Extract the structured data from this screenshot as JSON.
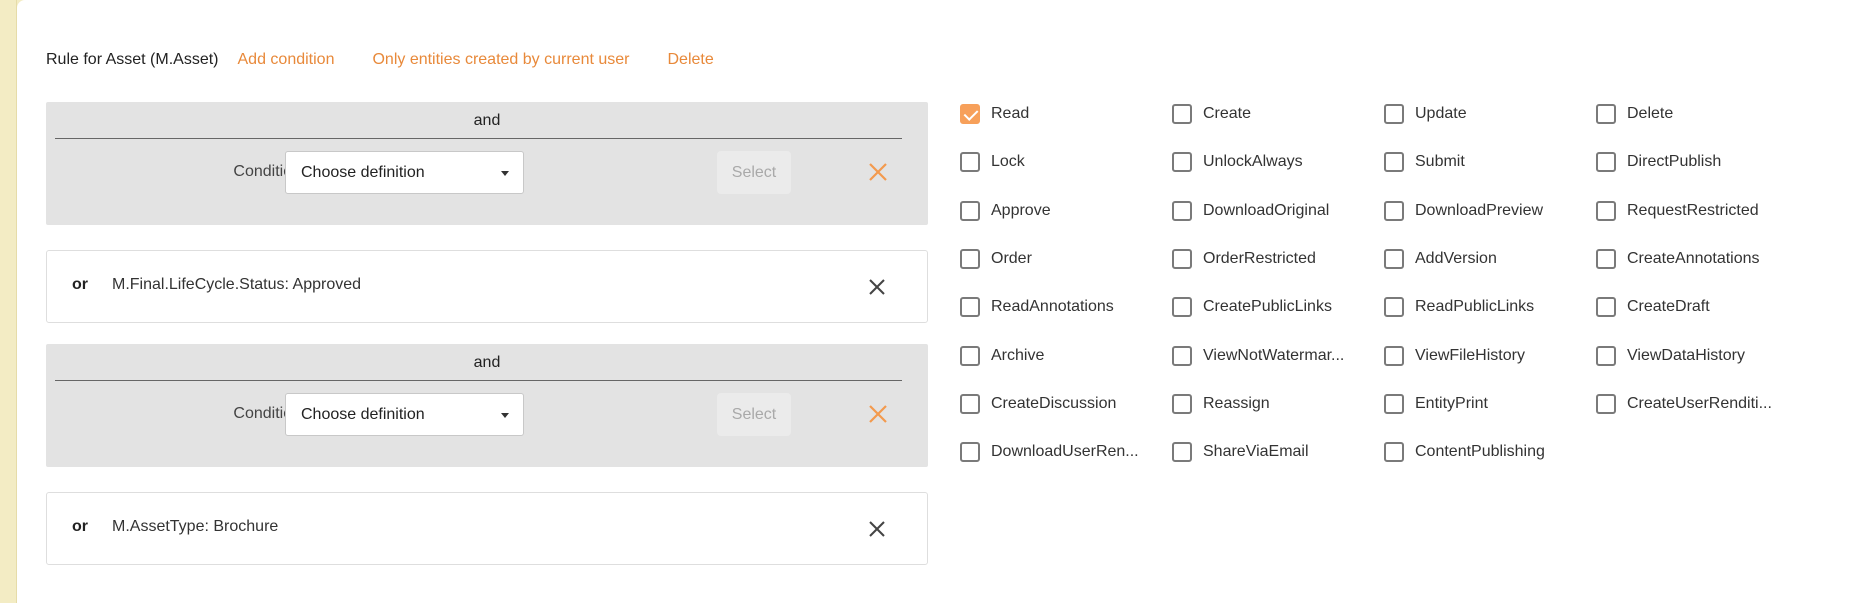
{
  "header": {
    "title": "Rule for Asset (M.Asset)",
    "add_condition": "Add condition",
    "only_current_user": "Only entities created by current user",
    "delete": "Delete"
  },
  "colors": {
    "accent": "#e8893a",
    "checkbox_checked": "#f7a05a",
    "and_block_bg": "#e3e3e3",
    "sidebar_strip": "#f3ecc4"
  },
  "conditions": [
    {
      "type": "and",
      "label": "and",
      "condition_label": "Condition",
      "select_value": "Choose definition",
      "select_button": "Select",
      "remove_icon": "close-icon-orange"
    },
    {
      "type": "or",
      "label": "or",
      "text": "M.Final.LifeCycle.Status: Approved",
      "remove_icon": "close-icon"
    },
    {
      "type": "and",
      "label": "and",
      "condition_label": "Condition",
      "select_value": "Choose definition",
      "select_button": "Select",
      "remove_icon": "close-icon-orange"
    },
    {
      "type": "or",
      "label": "or",
      "text": "M.AssetType: Brochure",
      "remove_icon": "close-icon"
    }
  ],
  "permissions": [
    {
      "label": "Read",
      "checked": true
    },
    {
      "label": "Create",
      "checked": false
    },
    {
      "label": "Update",
      "checked": false
    },
    {
      "label": "Delete",
      "checked": false
    },
    {
      "label": "Lock",
      "checked": false
    },
    {
      "label": "UnlockAlways",
      "checked": false
    },
    {
      "label": "Submit",
      "checked": false
    },
    {
      "label": "DirectPublish",
      "checked": false
    },
    {
      "label": "Approve",
      "checked": false
    },
    {
      "label": "DownloadOriginal",
      "checked": false
    },
    {
      "label": "DownloadPreview",
      "checked": false
    },
    {
      "label": "RequestRestricted",
      "checked": false
    },
    {
      "label": "Order",
      "checked": false
    },
    {
      "label": "OrderRestricted",
      "checked": false
    },
    {
      "label": "AddVersion",
      "checked": false
    },
    {
      "label": "CreateAnnotations",
      "checked": false
    },
    {
      "label": "ReadAnnotations",
      "checked": false
    },
    {
      "label": "CreatePublicLinks",
      "checked": false
    },
    {
      "label": "ReadPublicLinks",
      "checked": false
    },
    {
      "label": "CreateDraft",
      "checked": false
    },
    {
      "label": "Archive",
      "checked": false
    },
    {
      "label": "ViewNotWatermar...",
      "checked": false
    },
    {
      "label": "ViewFileHistory",
      "checked": false
    },
    {
      "label": "ViewDataHistory",
      "checked": false
    },
    {
      "label": "CreateDiscussion",
      "checked": false
    },
    {
      "label": "Reassign",
      "checked": false
    },
    {
      "label": "EntityPrint",
      "checked": false
    },
    {
      "label": "CreateUserRenditi...",
      "checked": false
    },
    {
      "label": "DownloadUserRen...",
      "checked": false
    },
    {
      "label": "ShareViaEmail",
      "checked": false
    },
    {
      "label": "ContentPublishing",
      "checked": false
    }
  ]
}
